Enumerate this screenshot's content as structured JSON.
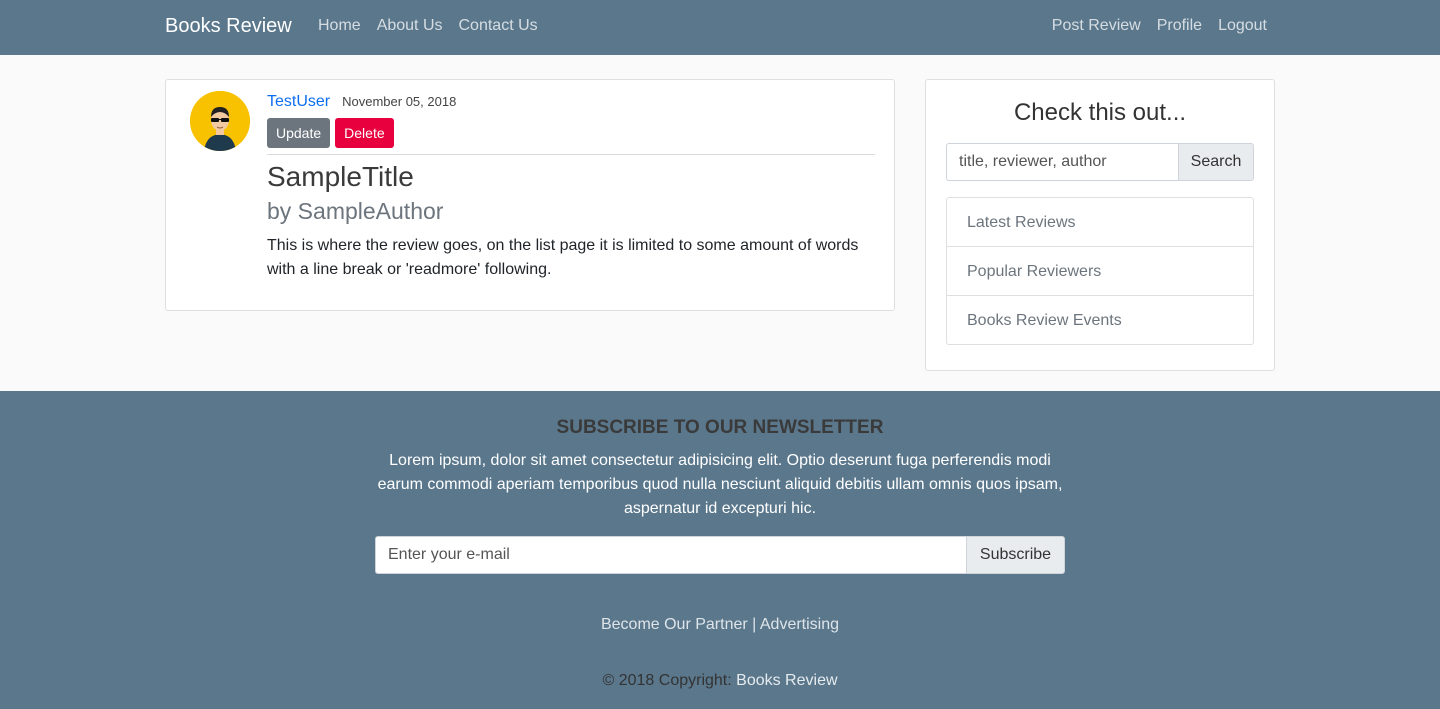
{
  "navbar": {
    "brand": "Books Review",
    "left_links": [
      "Home",
      "About Us",
      "Contact Us"
    ],
    "right_links": [
      "Post Review",
      "Profile",
      "Logout"
    ]
  },
  "review": {
    "username": "TestUser",
    "date": "November 05, 2018",
    "update_label": "Update",
    "delete_label": "Delete",
    "title": "SampleTitle",
    "author": "by SampleAuthor",
    "text": "This is where the review goes, on the list page it is limited to some amount of words with a line break or 'readmore' following."
  },
  "sidebar": {
    "title": "Check this out...",
    "search_placeholder": "title, reviewer, author",
    "search_button": "Search",
    "items": [
      "Latest Reviews",
      "Popular Reviewers",
      "Books Review Events"
    ]
  },
  "footer": {
    "newsletter_title": "SUBSCRIBE TO OUR NEWSLETTER",
    "newsletter_text": "Lorem ipsum, dolor sit amet consectetur adipisicing elit. Optio deserunt fuga perferendis modi earum commodi aperiam temporibus quod nulla nesciunt aliquid debitis ullam omnis quos ipsam, aspernatur id excepturi hic.",
    "email_placeholder": "Enter your e-mail",
    "subscribe_button": "Subscribe",
    "partner_link": "Become Our Partner",
    "separator": "|",
    "advertising_link": "Advertising",
    "copyright_prefix": "© 2018 Copyright:",
    "copyright_link": "Books Review"
  },
  "colors": {
    "navbar_bg": "#5a778c",
    "link_blue": "#0d6ef0",
    "delete_red": "#e8003e",
    "update_gray": "#6c757d",
    "avatar_yellow": "#f8c200"
  },
  "icons": {
    "avatar": "user-with-sunglasses-icon"
  }
}
